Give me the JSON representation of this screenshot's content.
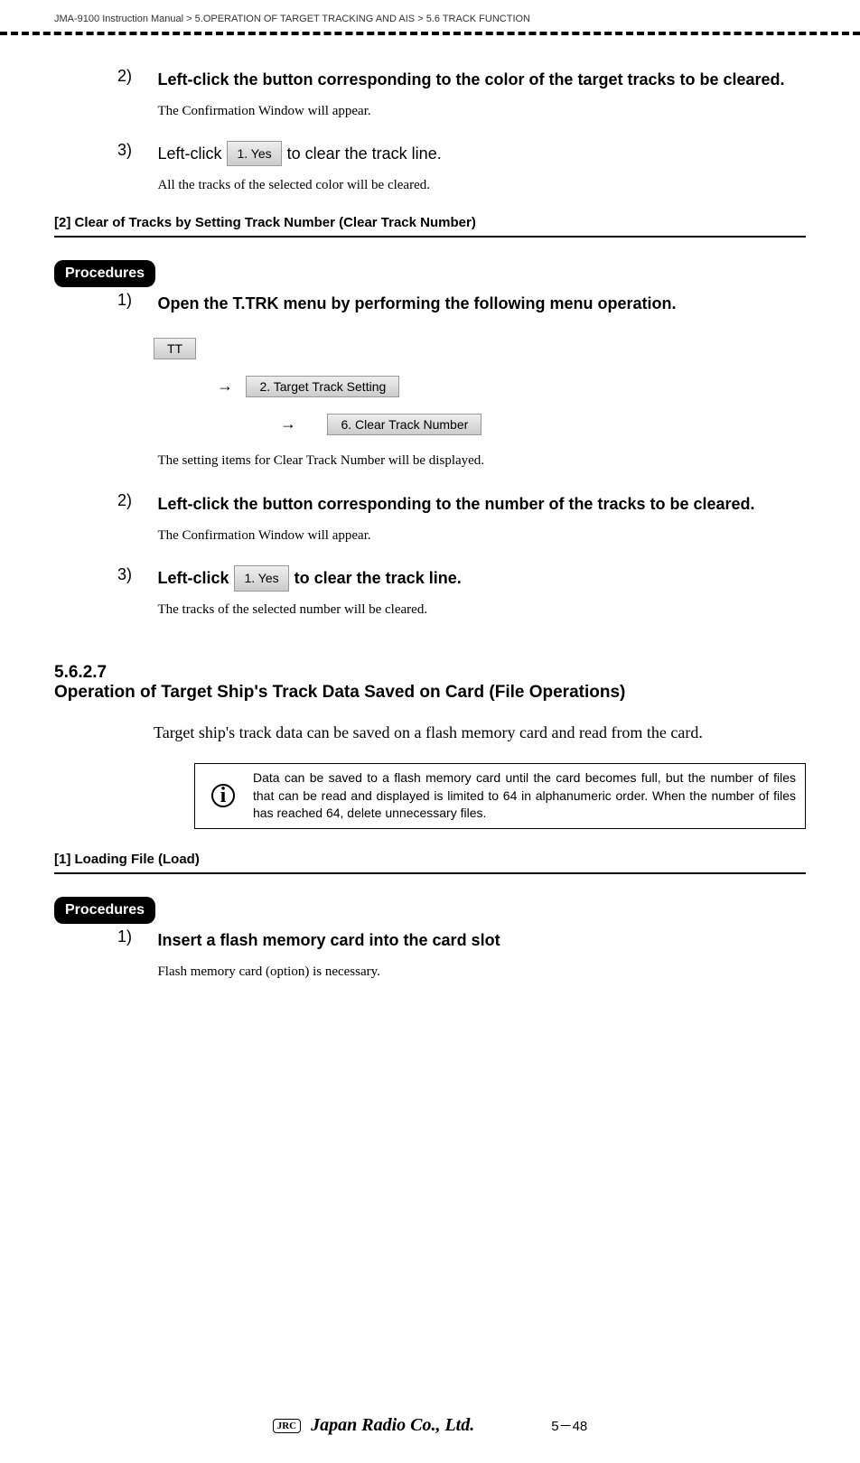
{
  "header": {
    "manual": "JMA-9100 Instruction Manual",
    "gt1": ">",
    "chapter": "5.OPERATION OF TARGET TRACKING AND AIS",
    "gt2": ">",
    "section": "5.6  TRACK FUNCTION"
  },
  "step2a": {
    "num": "2)",
    "title": "Left-click the button corresponding to the color of the target tracks to be cleared.",
    "desc": "The Confirmation Window will appear."
  },
  "step3a": {
    "num": "3)",
    "pre": "Left-click ",
    "btn": "1. Yes",
    "post": " to clear the track line.",
    "desc": "All the tracks of the selected color will be cleared."
  },
  "section2": {
    "title": "[2] Clear of Tracks by Setting Track Number (Clear Track Number)"
  },
  "procedures": "Procedures",
  "step1b": {
    "num": "1)",
    "title": "Open the T.TRK menu by performing the following menu operation.",
    "menu1": "TT",
    "arrow": "→",
    "menu2": "2. Target Track Setting",
    "menu3": "6. Clear Track Number",
    "desc": "The setting items for Clear Track Number will be displayed."
  },
  "step2b": {
    "num": "2)",
    "title": "Left-click the button corresponding to the number of the tracks to be cleared.",
    "desc": "The Confirmation Window will appear."
  },
  "step3b": {
    "num": "3)",
    "pre": "Left-click ",
    "btn": "1. Yes",
    "post": " to clear the track line.",
    "desc": "The tracks of the selected number will be cleared."
  },
  "chapter": {
    "num": "5.6.2.7",
    "title": "Operation of Target Ship's Track Data Saved on Card  (File Operations)",
    "body": "Target ship's track data can be saved on a flash memory card and read from the card."
  },
  "info": {
    "icon": "i",
    "text": "Data can be saved to a flash memory card until the card becomes full, but the number of files that can be read and displayed is limited to 64 in alphanumeric order. When the number of files has reached 64, delete unnecessary files."
  },
  "section1_sub": {
    "title": "[1] Loading File (Load)"
  },
  "step1c": {
    "num": "1)",
    "title": "Insert a flash memory card into the card slot",
    "desc": "Flash memory card (option) is necessary."
  },
  "footer": {
    "jrc": "JRC",
    "company": "Japan Radio Co., Ltd.",
    "page": "5－48"
  }
}
